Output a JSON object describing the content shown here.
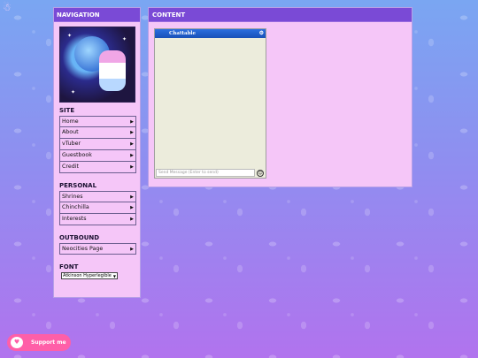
{
  "nav": {
    "header": "NAVIGATION",
    "sections": [
      {
        "title": "SITE",
        "items": [
          "Home",
          "About",
          "vTuber",
          "Guestbook",
          "Credit"
        ]
      },
      {
        "title": "PERSONAL",
        "items": [
          "Shrines",
          "Chinchilla",
          "Interests"
        ]
      },
      {
        "title": "OUTBOUND",
        "items": [
          "Neocities Page"
        ]
      }
    ],
    "font_title": "FONT",
    "font_selected": "Atkinson Hyperlegible"
  },
  "content": {
    "header": "CONTENT",
    "chat": {
      "title": "Chattable",
      "input_placeholder": "Send Message (Enter to send)"
    }
  },
  "support": {
    "label": "Support me"
  },
  "icons": {
    "arrow": "chevron-right-icon",
    "gear": "gear-icon",
    "emoji": "smiley-icon",
    "cup": "ko-fi-cup-icon"
  },
  "colors": {
    "header": "#7a4ad6",
    "panel": "#f5c6f8",
    "chat_header": "#2b6fe0",
    "support": "#ff5fa8"
  }
}
